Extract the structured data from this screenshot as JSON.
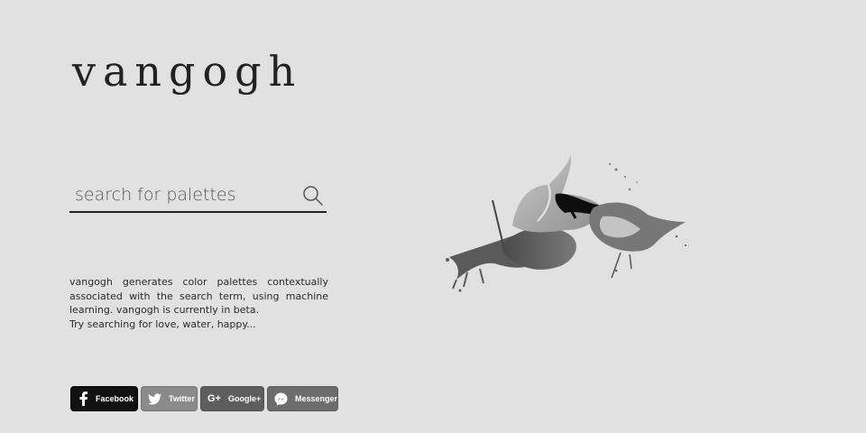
{
  "header": {
    "logo": "vangogh"
  },
  "search": {
    "placeholder": "search for palettes"
  },
  "description": {
    "line1": "vangogh generates color palettes contextually",
    "line2": "associated with the search term, using machine",
    "line3": "learning. vangogh is currently in beta.",
    "line4": "Try searching for love, water, happy..."
  },
  "share": {
    "facebook": "Facebook",
    "twitter": "Twitter",
    "googleplus": "Google+",
    "messenger": "Messenger"
  },
  "colors": {
    "background": "#e1e1e1",
    "text": "#222222",
    "facebook_bg": "#111111",
    "twitter_bg": "#8a8a8a",
    "googleplus_bg": "#5e5e5e",
    "messenger_bg": "#6c6c6c"
  }
}
